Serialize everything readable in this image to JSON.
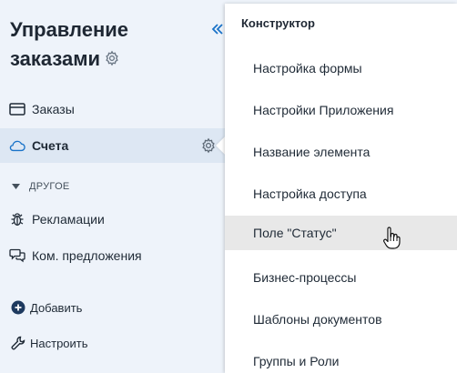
{
  "app": {
    "title": "Управление заказами"
  },
  "sidebar": {
    "items": [
      {
        "label": "Заказы",
        "icon": "card-icon"
      },
      {
        "label": "Счета",
        "icon": "cloud-icon",
        "active": true
      }
    ],
    "section": {
      "label": "ДРУГОЕ"
    },
    "other_items": [
      {
        "label": "Рекламации",
        "icon": "bug-icon"
      },
      {
        "label": "Ком. предложения",
        "icon": "chat-icon"
      }
    ],
    "actions": {
      "add_label": "Добавить",
      "configure_label": "Настроить"
    }
  },
  "menu": {
    "header": "Конструктор",
    "items": [
      {
        "label": "Настройка формы"
      },
      {
        "label": "Настройки Приложения"
      },
      {
        "label": "Название элемента"
      },
      {
        "label": "Настройка доступа"
      },
      {
        "label": "Поле \"Статус\"",
        "hovered": true
      },
      {
        "label": "Бизнес-процессы"
      },
      {
        "label": "Шаблоны документов"
      },
      {
        "label": "Группы и Роли"
      }
    ]
  },
  "colors": {
    "accent": "#1a73c8",
    "active_bg": "#dde7f3",
    "sidebar_bg": "#eef3fa",
    "hover_bg": "#e8e8e8"
  }
}
